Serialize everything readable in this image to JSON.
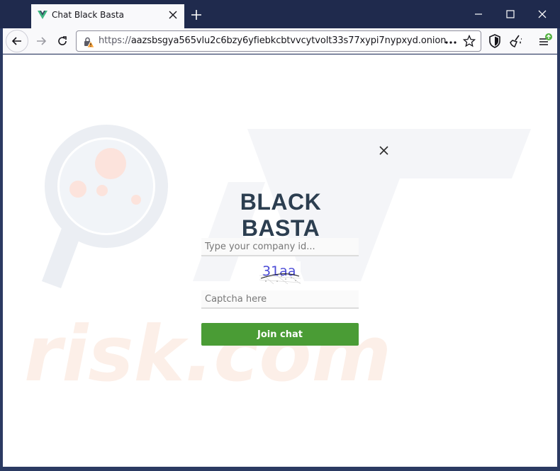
{
  "browser": {
    "tab_title": "Chat Black Basta",
    "url_scheme": "https://",
    "url_host": "aazsbsgya565vlu2c6bzy6yfiebkcbtvvcytvolt33s77xypi7nypxyd.onion",
    "icons": [
      "vue-favicon-icon",
      "close-icon",
      "plus-icon",
      "minimize-icon",
      "maximize-icon",
      "close-window-icon",
      "back-arrow-icon",
      "forward-arrow-icon",
      "reload-icon",
      "warning-lock-icon",
      "more-icon",
      "star-icon",
      "shield-icon",
      "broom-icon",
      "hamburger-menu-icon"
    ],
    "colors": {
      "titlebar": "#1f2a4d",
      "accent_green": "#4a9c35",
      "brand_text": "#2c3e50"
    }
  },
  "page": {
    "brand": "BLACK BASTA",
    "company_placeholder": "Type your company id...",
    "captcha_text": "31aa",
    "captcha_placeholder": "Captcha here",
    "join_label": "Join chat"
  }
}
